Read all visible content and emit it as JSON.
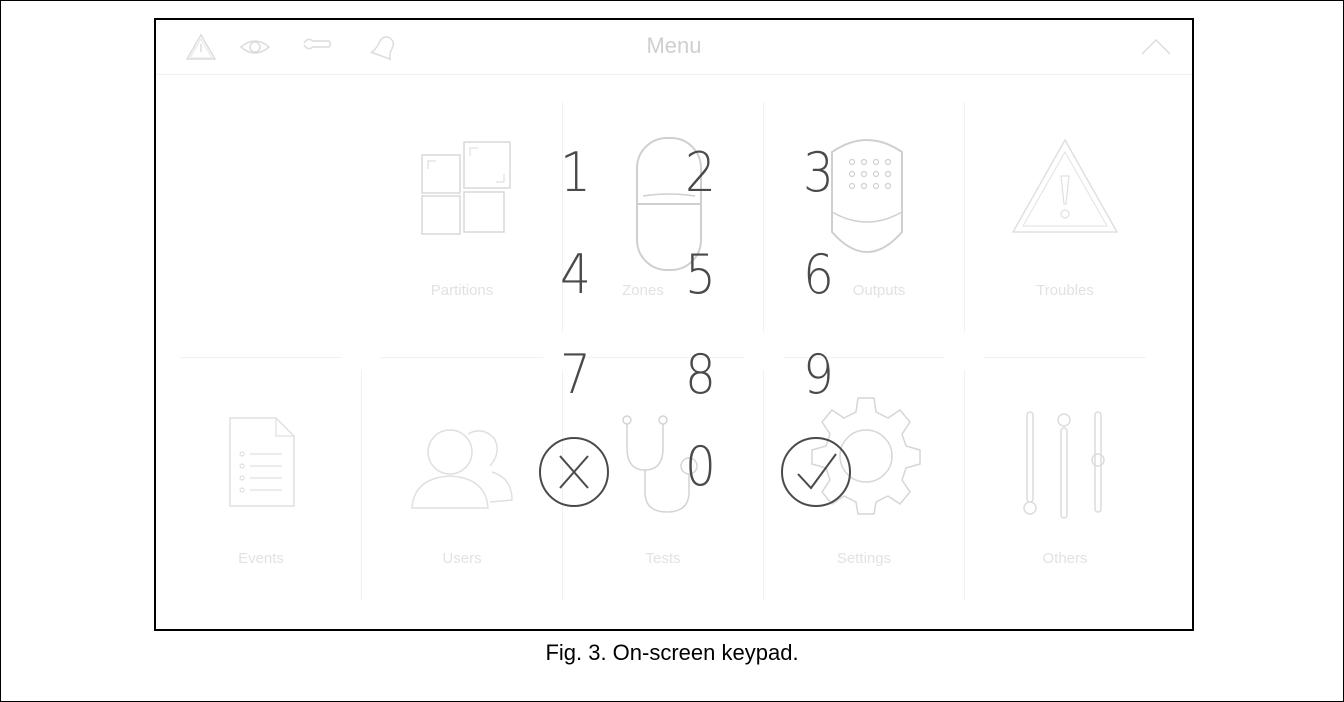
{
  "screen": {
    "title": "Menu",
    "status_icons": [
      "warning-icon",
      "eye-icon",
      "wrench-icon",
      "bell-icon"
    ],
    "collapse_icon": "chevron-up-icon"
  },
  "tiles": [
    {
      "label": "Partitions",
      "icon": "partitions-icon"
    },
    {
      "label": "Zones",
      "icon": "detector-icon"
    },
    {
      "label": "Outputs",
      "icon": "keypad-device-icon"
    },
    {
      "label": "Troubles",
      "icon": "warning-triangle-icon"
    },
    {
      "label": "Events",
      "icon": "document-list-icon"
    },
    {
      "label": "Users",
      "icon": "users-icon"
    },
    {
      "label": "Tests",
      "icon": "stethoscope-icon"
    },
    {
      "label": "Settings",
      "icon": "gear-icon"
    },
    {
      "label": "Others",
      "icon": "sliders-icon"
    }
  ],
  "keypad": {
    "keys": [
      "1",
      "2",
      "3",
      "4",
      "5",
      "6",
      "7",
      "8",
      "9",
      "0"
    ],
    "cancel_icon": "cancel-circle-icon",
    "confirm_icon": "confirm-check-icon"
  },
  "caption": "Fig. 3. On-screen keypad.",
  "colors": {
    "key_text": "#4a4a4a",
    "faded_icon": "#d8d8d8",
    "faded_label": "#e2e2e2"
  }
}
